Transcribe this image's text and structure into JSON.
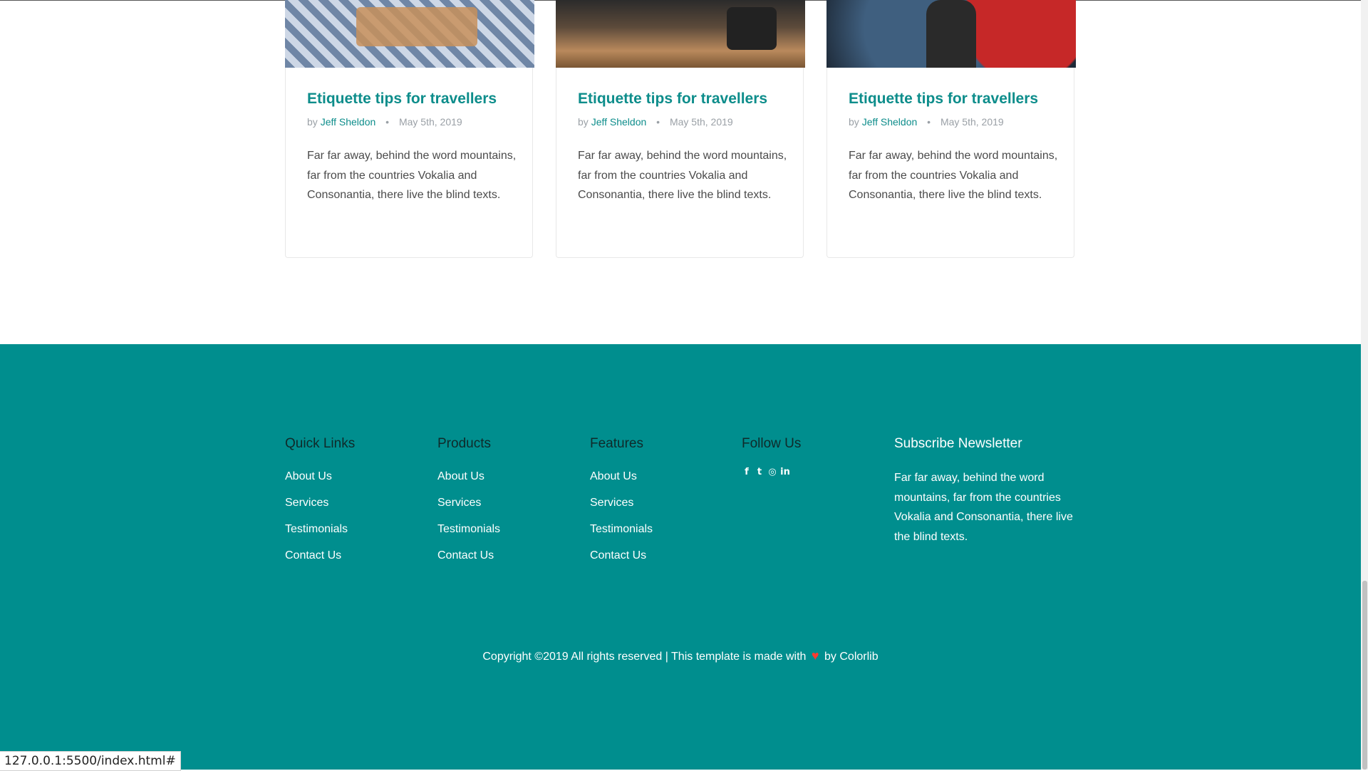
{
  "blog": {
    "cards": [
      {
        "title": "Etiquette tips for travellers",
        "by": "by",
        "author": "Jeff Sheldon",
        "separator": "•",
        "date": "May 5th, 2019",
        "excerpt": "Far far away, behind the word mountains, far from the countries Vokalia and Consonantia, there live the blind texts."
      },
      {
        "title": "Etiquette tips for travellers",
        "by": "by",
        "author": "Jeff Sheldon",
        "separator": "•",
        "date": "May 5th, 2019",
        "excerpt": "Far far away, behind the word mountains, far from the countries Vokalia and Consonantia, there live the blind texts."
      },
      {
        "title": "Etiquette tips for travellers",
        "by": "by",
        "author": "Jeff Sheldon",
        "separator": "•",
        "date": "May 5th, 2019",
        "excerpt": "Far far away, behind the word mountains, far from the countries Vokalia and Consonantia, there live the blind texts."
      }
    ]
  },
  "footer": {
    "columns": [
      {
        "heading": "Quick Links",
        "links": [
          "About Us",
          "Services",
          "Testimonials",
          "Contact Us"
        ]
      },
      {
        "heading": "Products",
        "links": [
          "About Us",
          "Services",
          "Testimonials",
          "Contact Us"
        ]
      },
      {
        "heading": "Features",
        "links": [
          "About Us",
          "Services",
          "Testimonials",
          "Contact Us"
        ]
      }
    ],
    "follow": {
      "heading": "Follow Us",
      "icons": [
        "facebook-icon",
        "twitter-icon",
        "instagram-icon",
        "linkedin-icon"
      ]
    },
    "newsletter": {
      "heading": "Subscribe Newsletter",
      "text": "Far far away, behind the word mountains, far from the countries Vokalia and Consonantia, there live the blind texts."
    },
    "copyright": {
      "before": "Copyright ©2019 All rights reserved | This template is made with",
      "after": "by Colorlib"
    }
  },
  "status_bar": {
    "url": "127.0.0.1:5500/index.html#"
  },
  "colors": {
    "accent": "#0d8d8b",
    "footer_bg": "#008e8e",
    "heart": "#ff3b30"
  }
}
